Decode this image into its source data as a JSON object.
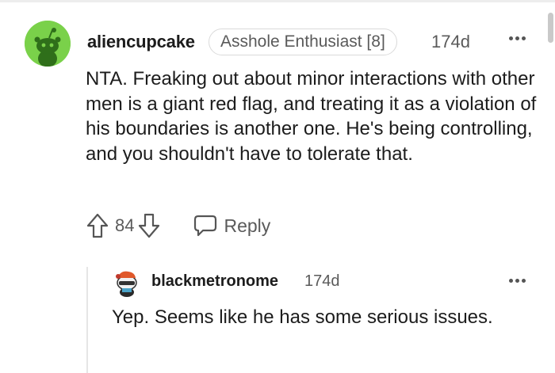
{
  "comment": {
    "username": "aliencupcake",
    "flair": "Asshole Enthusiast [8]",
    "age": "174d",
    "body": "NTA. Freaking out about minor interactions with other men is a giant red flag, and treating it as a violation of his boundaries is another one. He's being controlling, and you shouldn't have to tolerate that.",
    "score": "84",
    "reply_label": "Reply"
  },
  "reply": {
    "username": "blackmetronome",
    "age": "174d",
    "body": "Yep. Seems like he has some serious issues."
  },
  "icons": {
    "upvote": "arrow-up-outline-icon",
    "downvote": "arrow-down-outline-icon",
    "reply": "speech-bubble-icon",
    "more": "more-horizontal-icon"
  },
  "colors": {
    "avatar_bg": "#7ad14a",
    "text": "#1c1c1c",
    "muted": "#5a5a5a"
  }
}
